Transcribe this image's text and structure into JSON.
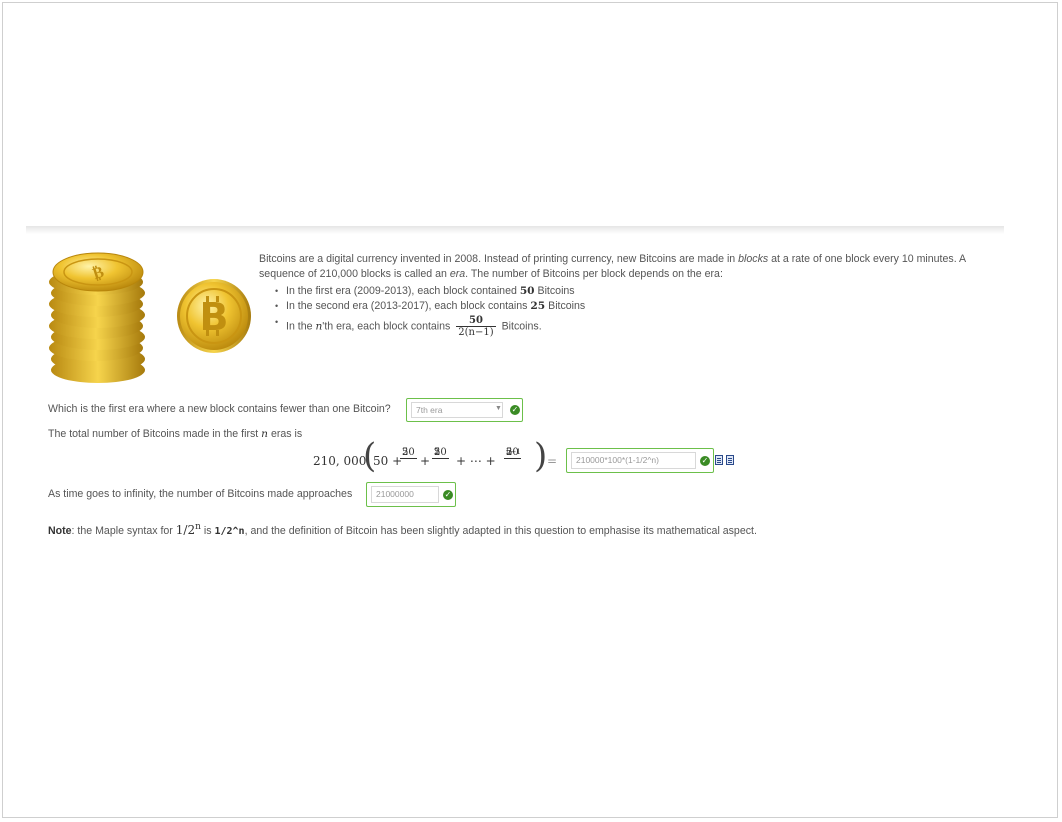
{
  "intro": {
    "line1": "Bitcoins are a digital currency invented in 2008. Instead of printing currency, new Bitcoins are made in",
    "blocks": "blocks",
    "line1_rest": "at a rate of one block every 10 minutes. A",
    "line2_a": "sequence of 210,000 blocks is called an",
    "era": "era",
    "line2_b": ". The number of Bitcoins per block depends on the era:",
    "bullet1_a": "In the first era (2009-2013), each block contained",
    "bullet1_val": "50",
    "bullet1_b": "Bitcoins",
    "bullet2_a": "In the second era (2013-2017), each block contains",
    "bullet2_val": "25",
    "bullet2_b": "Bitcoins",
    "bullet3_a": "In the",
    "bullet3_n": "n",
    "bullet3_b": "'th era, each block contains",
    "bullet3_num": "50",
    "bullet3_den": "2(n−1)",
    "bullet3_c": "Bitcoins."
  },
  "q1": {
    "text": "Which is the first era where a new block contains fewer than one Bitcoin?",
    "selected": "7th era"
  },
  "q2": {
    "text_a": "The total number of Bitcoins made in the first",
    "n": "n",
    "text_b": "eras is",
    "f_lead": "210, 000",
    "f_50": "50 +",
    "f_frac1_num": "50",
    "f_frac1_den": "2",
    "f_plus1": "+",
    "f_frac2_num": "50",
    "f_frac2_den": "2",
    "f_frac2_exp": "2",
    "f_dots": "+ ⋯ +",
    "f_frac3_num": "50",
    "f_frac3_den": "2",
    "f_frac3_exp": "n−1",
    "f_eq": "=",
    "value": "210000*100*(1-1/2^n)"
  },
  "q3": {
    "text": "As time goes to infinity, the number of Bitcoins made approaches",
    "value": "21000000"
  },
  "note": {
    "label": "Note",
    "a": ": the Maple syntax for",
    "expr1": "1/2",
    "expr1_exp": "n",
    "b": "is",
    "code": "1/2^n",
    "c": ", and the definition of Bitcoin has been slightly adapted in this question to emphasise its mathematical aspect."
  },
  "colors": {
    "accent_green": "#6cc04a",
    "check_green": "#3a8b24",
    "coin_gold": "#e6b422"
  },
  "icons": [
    "bitcoin-coin-stack",
    "bitcoin-coin",
    "check-icon",
    "maple-preview-icon",
    "maple-syntax-icon",
    "dropdown-arrow-icon"
  ]
}
